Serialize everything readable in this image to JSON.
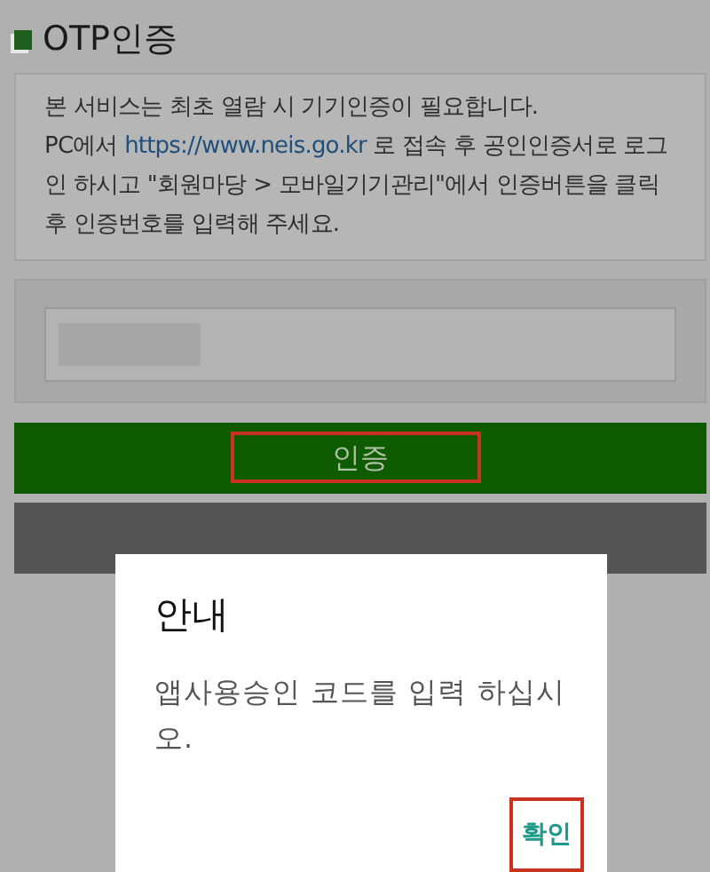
{
  "section": {
    "title": "OTP인증"
  },
  "notice": {
    "intro": "본 서비스는 최초 열람 시 기기인증이 필요합니다.",
    "before_link": "PC에서 ",
    "link": "https://www.neis.go.kr",
    "after_link": " 로 접속 후 공인인증서로 로그인 하시고 \"회원마당 > 모바일기기관리\"에서 인증버튼을 클릭 후 인증번호를 입력해 주세요."
  },
  "verify_button": {
    "label": "인증"
  },
  "dialog": {
    "title": "안내",
    "message": "앱사용승인 코드를 입력 하십시오.",
    "confirm": "확인"
  }
}
